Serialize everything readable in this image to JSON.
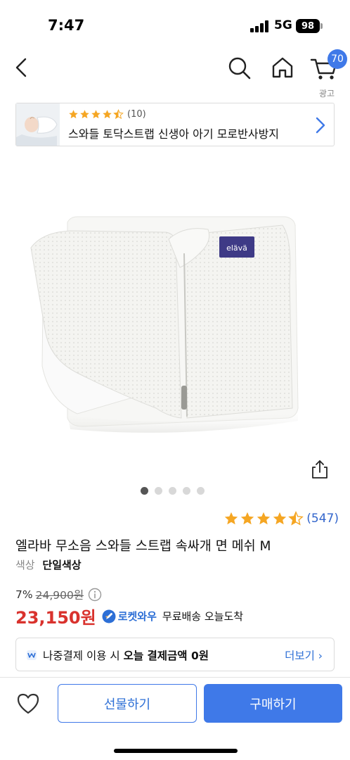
{
  "status_bar": {
    "time": "7:47",
    "network": "5G",
    "battery": "98"
  },
  "nav": {
    "back_icon": "chevron-left-icon",
    "search_icon": "search-icon",
    "home_icon": "home-icon",
    "cart_icon": "cart-icon",
    "cart_count": "70",
    "ad_label": "광고"
  },
  "ad": {
    "rating": 4.5,
    "review_count": "(10)",
    "title": "스와들 토닥스트랩 신생아 아기 모로반사방지",
    "chevron_icon": "chevron-right-icon"
  },
  "product_image": {
    "brand_label": "elävä",
    "share_icon": "share-icon",
    "dots_total": 5,
    "dots_active": 1
  },
  "product": {
    "rating": 4.5,
    "review_count": "(547)",
    "title": "엘라바 무소음 스와들 스트랩 속싸개 면 메쉬 M",
    "option_key": "색상",
    "option_value": "단일색상",
    "discount": "7%",
    "original_price": "24,900원",
    "sale_price": "23,150원",
    "rocket_label": "로켓와우",
    "delivery": "무료배송 오늘도착"
  },
  "later_pay": {
    "text_prefix": "나중결제 이용 시 ",
    "text_bold": "오늘 결제금액 0원",
    "more_label": "더보기"
  },
  "bottom": {
    "heart_icon": "heart-icon",
    "gift_label": "선물하기",
    "buy_label": "구매하기"
  },
  "colors": {
    "accent": "#3f79e8",
    "price_red": "#d9322d",
    "star": "#f5a623"
  }
}
